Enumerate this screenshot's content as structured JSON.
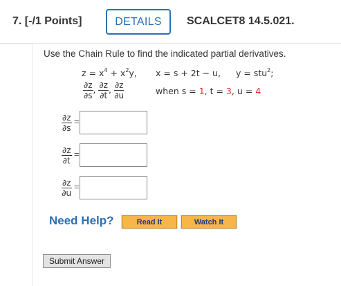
{
  "question": {
    "number_points": "7.  [-/1 Points]",
    "details_label": "DETAILS",
    "code": "SCALCET8 14.5.021."
  },
  "problem": {
    "prompt": "Use the Chain Rule to find the indicated partial derivatives.",
    "z_def": "z = x⁴ + x²y,",
    "x_def": "x = s + 2t − u,",
    "y_def": "y = stu²;",
    "derivs": {
      "dz_ds": {
        "num": "∂z",
        "den": "∂s"
      },
      "dz_dt": {
        "num": "∂z",
        "den": "∂t"
      },
      "dz_du": {
        "num": "∂z",
        "den": "∂u"
      }
    },
    "when_label": "when s =",
    "s_value": "1",
    "t_label": ", t =",
    "t_value": "3",
    "u_label": ", u =",
    "u_value": "4"
  },
  "answers": {
    "equals": "=",
    "dz_ds": {
      "num": "∂z",
      "den": "∂s",
      "value": ""
    },
    "dz_dt": {
      "num": "∂z",
      "den": "∂t",
      "value": ""
    },
    "dz_du": {
      "num": "∂z",
      "den": "∂u",
      "value": ""
    }
  },
  "help": {
    "need_help": "Need Help?",
    "read_it": "Read It",
    "watch_it": "Watch It"
  },
  "submit_label": "Submit Answer",
  "colors": {
    "accent_blue": "#2b6fb6",
    "help_button": "#f7b54a",
    "given_value_red": "#d33333"
  }
}
